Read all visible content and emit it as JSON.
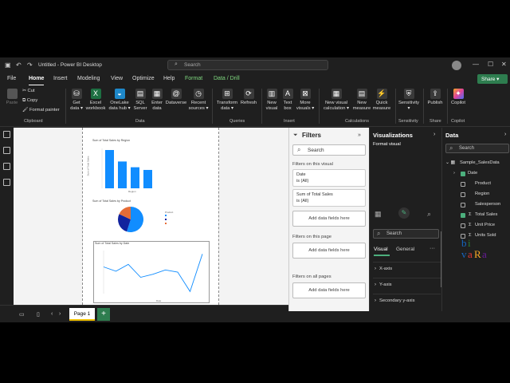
{
  "titlebar": {
    "title": "Untitled - Power BI Desktop",
    "search_placeholder": "Search"
  },
  "menu": {
    "items": [
      "File",
      "Home",
      "Insert",
      "Modeling",
      "View",
      "Optimize",
      "Help",
      "Format",
      "Data / Drill"
    ],
    "active": "Home",
    "share": "Share"
  },
  "ribbon": {
    "clipboard": {
      "paste": "Paste",
      "cut": "Cut",
      "copy": "Copy",
      "format_painter": "Format painter",
      "group": "Clipboard"
    },
    "data": {
      "get_data": "Get\ndata",
      "excel": "Excel\nworkbook",
      "onelake": "OneLake\ndata hub",
      "sql": "SQL\nServer",
      "enter": "Enter\ndata",
      "dataverse": "Dataverse",
      "recent": "Recent\nsources",
      "group": "Data"
    },
    "queries": {
      "transform": "Transform\ndata",
      "refresh": "Refresh",
      "group": "Queries"
    },
    "insert": {
      "new_visual": "New\nvisual",
      "text_box": "Text\nbox",
      "more_visuals": "More\nvisuals",
      "group": "Insert"
    },
    "calculations": {
      "new_visual_calc": "New visual\ncalculation",
      "new_measure": "New\nmeasure",
      "quick_measure": "Quick\nmeasure",
      "group": "Calculations"
    },
    "sensitivity": {
      "label": "Sensitivity",
      "group": "Sensitivity"
    },
    "share": {
      "publish": "Publish",
      "group": "Share"
    },
    "copilot": {
      "label": "Copilot",
      "group": "Copilot"
    }
  },
  "canvas": {
    "bar_chart_title": "Sum of Total Sales by Region",
    "bar_xlabel": "Region",
    "bar_ylabel": "Sum of Total Sales",
    "pie_chart_title": "Sum of Total Sales by Product",
    "pie_legend_title": "Product",
    "line_chart_title": "Sum of Total Sales by Date",
    "line_xlabel": "Date",
    "line_ylabel": "Sum of Total Sales"
  },
  "chart_data": [
    {
      "type": "bar",
      "title": "Sum of Total Sales by Region",
      "xlabel": "Region",
      "ylabel": "Sum of Total Sales",
      "series": [
        {
          "values": [
            1.0,
            0.7,
            0.55,
            0.48
          ]
        }
      ]
    },
    {
      "type": "pie",
      "title": "Sum of Total Sales by Product",
      "series": [
        {
          "values": [
            0.55,
            0.27,
            0.18
          ],
          "colors": [
            "#118DFF",
            "#12239E",
            "#E66C37"
          ]
        }
      ]
    },
    {
      "type": "line",
      "title": "Sum of Total Sales by Date",
      "xlabel": "Date",
      "ylabel": "Sum of Total Sales",
      "series": [
        {
          "values": [
            0.62,
            0.52,
            0.68,
            0.38,
            0.45,
            0.55,
            0.5,
            0.05,
            0.92
          ]
        }
      ]
    }
  ],
  "filters": {
    "title": "Filters",
    "search": "Search",
    "on_visual": "Filters on this visual",
    "card1_name": "Date",
    "card1_value": "is (All)",
    "card2_name": "Sum of Total Sales",
    "card2_value": "is (All)",
    "add_fields": "Add data fields here",
    "on_page": "Filters on this page",
    "on_all_pages": "Filters on all pages"
  },
  "visualizations": {
    "title": "Visualizations",
    "format_visual": "Format visual",
    "search": "Search",
    "tab_visual": "Visual",
    "tab_general": "General",
    "sections": [
      "X-axis",
      "Y-axis",
      "Secondary y-axis",
      "Legend",
      "Small multiples",
      "Gridlines",
      "Zoom slider"
    ],
    "off": "Off"
  },
  "data_pane": {
    "title": "Data",
    "search": "Search",
    "table": "Sample_SalesData",
    "fields": [
      "Date",
      "Product",
      "Region",
      "Salesperson",
      "Total Sales",
      "Unit Price",
      "Units Sold"
    ]
  },
  "page_tabs": {
    "page1": "Page 1"
  },
  "watermark": {
    "text": "bivaRa"
  }
}
